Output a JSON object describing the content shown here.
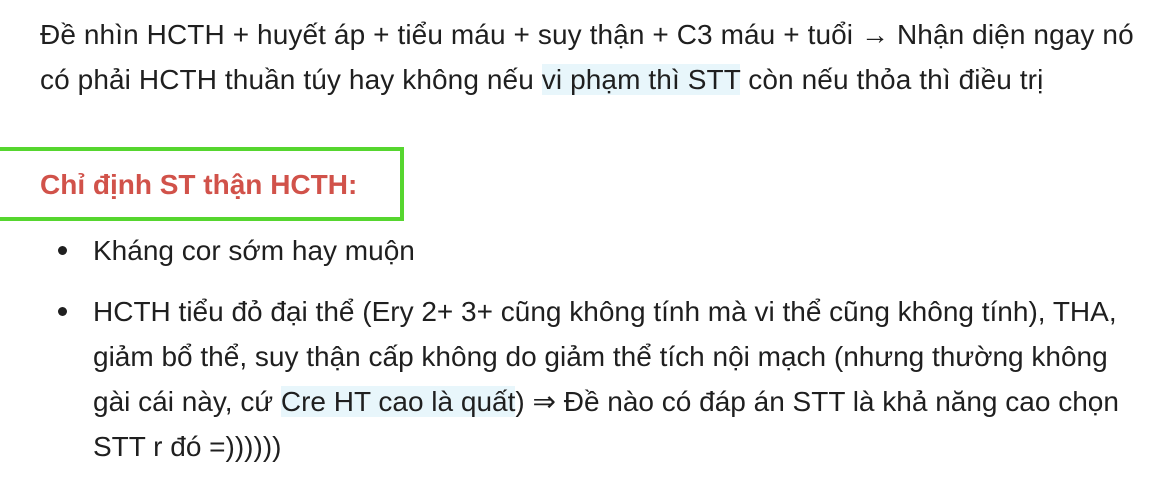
{
  "intro": {
    "part1": "Đề nhìn HCTH + huyết áp + tiểu máu + suy thận + C3 máu + tuổi → Nhận diện ngay nó có phải HCTH thuần túy hay không nếu ",
    "highlight": "vi phạm thì STT",
    "part2": " còn nếu thỏa thì điều trị"
  },
  "heading": "Chỉ định ST thận HCTH:",
  "list": {
    "item1": "Kháng cor sớm hay muộn",
    "item2": {
      "part1": "HCTH tiểu đỏ đại thể (Ery 2+ 3+ cũng không tính mà vi thể cũng không tính), THA, giảm bổ thể, suy thận cấp không do giảm thể tích nội mạch (nhưng thường không gài cái này, cứ ",
      "highlight": "Cre HT cao là quất",
      "part2": ") ⇒ Đề nào có đáp án STT là khả năng cao chọn STT r đó =))))))"
    }
  },
  "colors": {
    "heading": "#d1524a",
    "highlight_bg": "#e8f6fb",
    "box_border": "#56d62f"
  }
}
